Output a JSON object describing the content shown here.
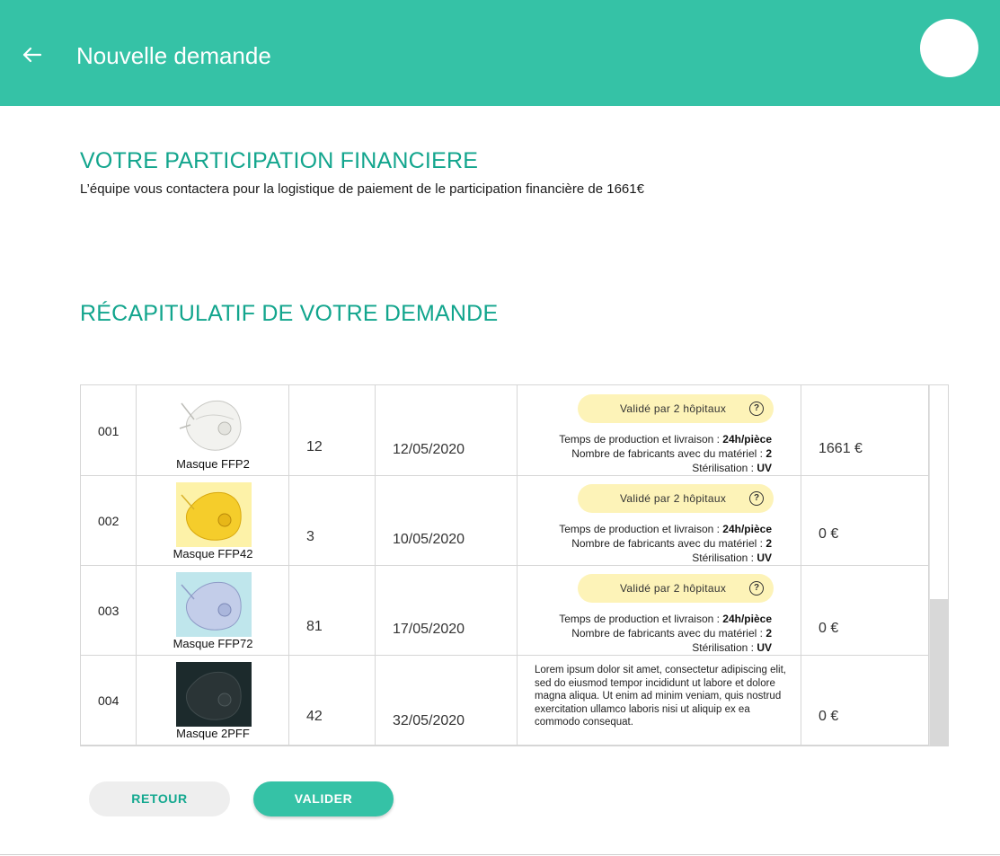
{
  "header": {
    "title": "Nouvelle demande",
    "back_icon": "arrow-left-icon",
    "bg_color": "#35c2a6"
  },
  "financial": {
    "title": "VOTRE PARTICIPATION FINANCIERE",
    "text": "L’équipe vous contactera pour la logistique de paiement de le participation financière de 1661€"
  },
  "summary": {
    "title": "RÉCAPITULATIF DE VOTRE DEMANDE",
    "rows": [
      {
        "id": "001",
        "product_name": "Masque FFP2",
        "product_color": "white",
        "quantity": "12",
        "date": "12/05/2020",
        "badge": "Validé par 2 hôpitaux",
        "line1_label": "Temps de production et livraison : ",
        "line1_value": "24h/pièce",
        "line2_label": "Nombre de fabricants avec du matériel : ",
        "line2_value": "2",
        "line3_label": "Stérilisation : ",
        "line3_value": "UV",
        "price": "1661 €"
      },
      {
        "id": "002",
        "product_name": "Masque FFP42",
        "product_color": "yellow",
        "quantity": "3",
        "date": "10/05/2020",
        "badge": "Validé par 2 hôpitaux",
        "line1_label": "Temps de production et livraison : ",
        "line1_value": "24h/pièce",
        "line2_label": "Nombre de fabricants avec du matériel : ",
        "line2_value": "2",
        "line3_label": "Stérilisation : ",
        "line3_value": "UV",
        "price": "0 €"
      },
      {
        "id": "003",
        "product_name": "Masque FFP72",
        "product_color": "blue",
        "quantity": "81",
        "date": "17/05/2020",
        "badge": "Validé par 2 hôpitaux",
        "line1_label": "Temps de production et livraison : ",
        "line1_value": "24h/pièce",
        "line2_label": "Nombre de fabricants avec du matériel : ",
        "line2_value": "2",
        "line3_label": "Stérilisation : ",
        "line3_value": "UV",
        "price": "0 €"
      },
      {
        "id": "004",
        "product_name": "Masque 2PFF",
        "product_color": "black",
        "quantity": "42",
        "date": "32/05/2020",
        "description": "Lorem ipsum dolor sit amet, consectetur adipiscing elit, sed do eiusmod tempor incididunt ut labore et dolore magna aliqua. Ut enim ad minim veniam, quis nostrud exercitation ullamco laboris nisi ut aliquip ex ea commodo consequat.",
        "price": "0 €"
      }
    ]
  },
  "actions": {
    "back_label": "RETOUR",
    "validate_label": "VALIDER"
  }
}
